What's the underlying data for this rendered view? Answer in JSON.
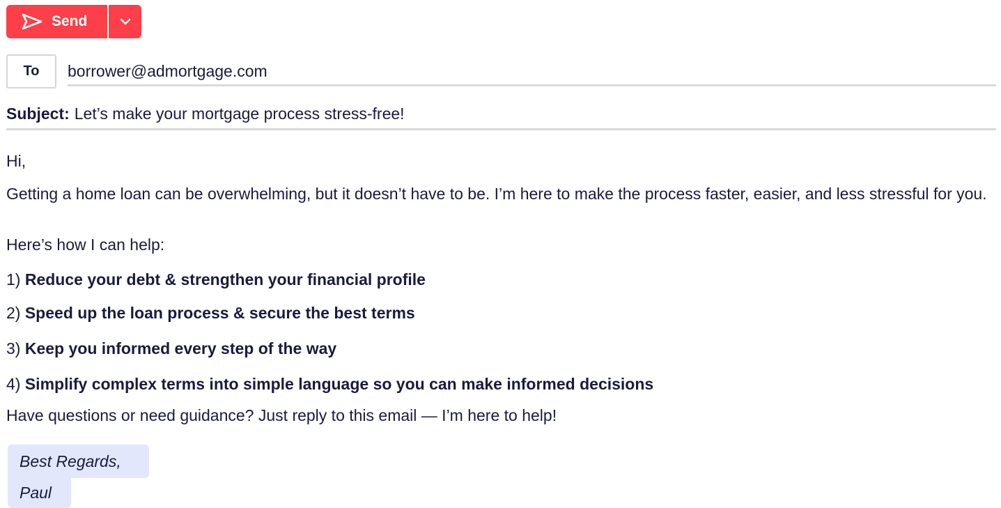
{
  "toolbar": {
    "send_label": "Send",
    "send_icon": "send-plane-icon",
    "menu_icon": "chevron-down-icon",
    "accent_color": "#fc3f48"
  },
  "header": {
    "to_label": "To",
    "to_value": "borrower@admortgage.com",
    "subject_label": "Subject:",
    "subject_value": "Let’s make your mortgage process stress-free!"
  },
  "body": {
    "greeting": "Hi,",
    "intro": "Getting a home loan can be overwhelming, but it doesn’t have to be. I’m here to make the process faster, easier, and less stressful for you.",
    "lead_in": "Here’s how I can help:",
    "items": [
      {
        "number": "1)",
        "text": "Reduce your debt & strengthen your financial profile"
      },
      {
        "number": "2)",
        "text": "Speed up the loan process & secure the best terms"
      },
      {
        "number": "3)",
        "text": "Keep you informed every step of the way"
      },
      {
        "number": "4)",
        "text": "Simplify complex terms into simple language so you can make informed decisions"
      }
    ],
    "closing": "Have questions or need guidance? Just reply to this email — I’m here to help!"
  },
  "signature": {
    "line1": "Best Regards,",
    "line2": "Paul",
    "highlight_color": "#e3e7fb"
  }
}
